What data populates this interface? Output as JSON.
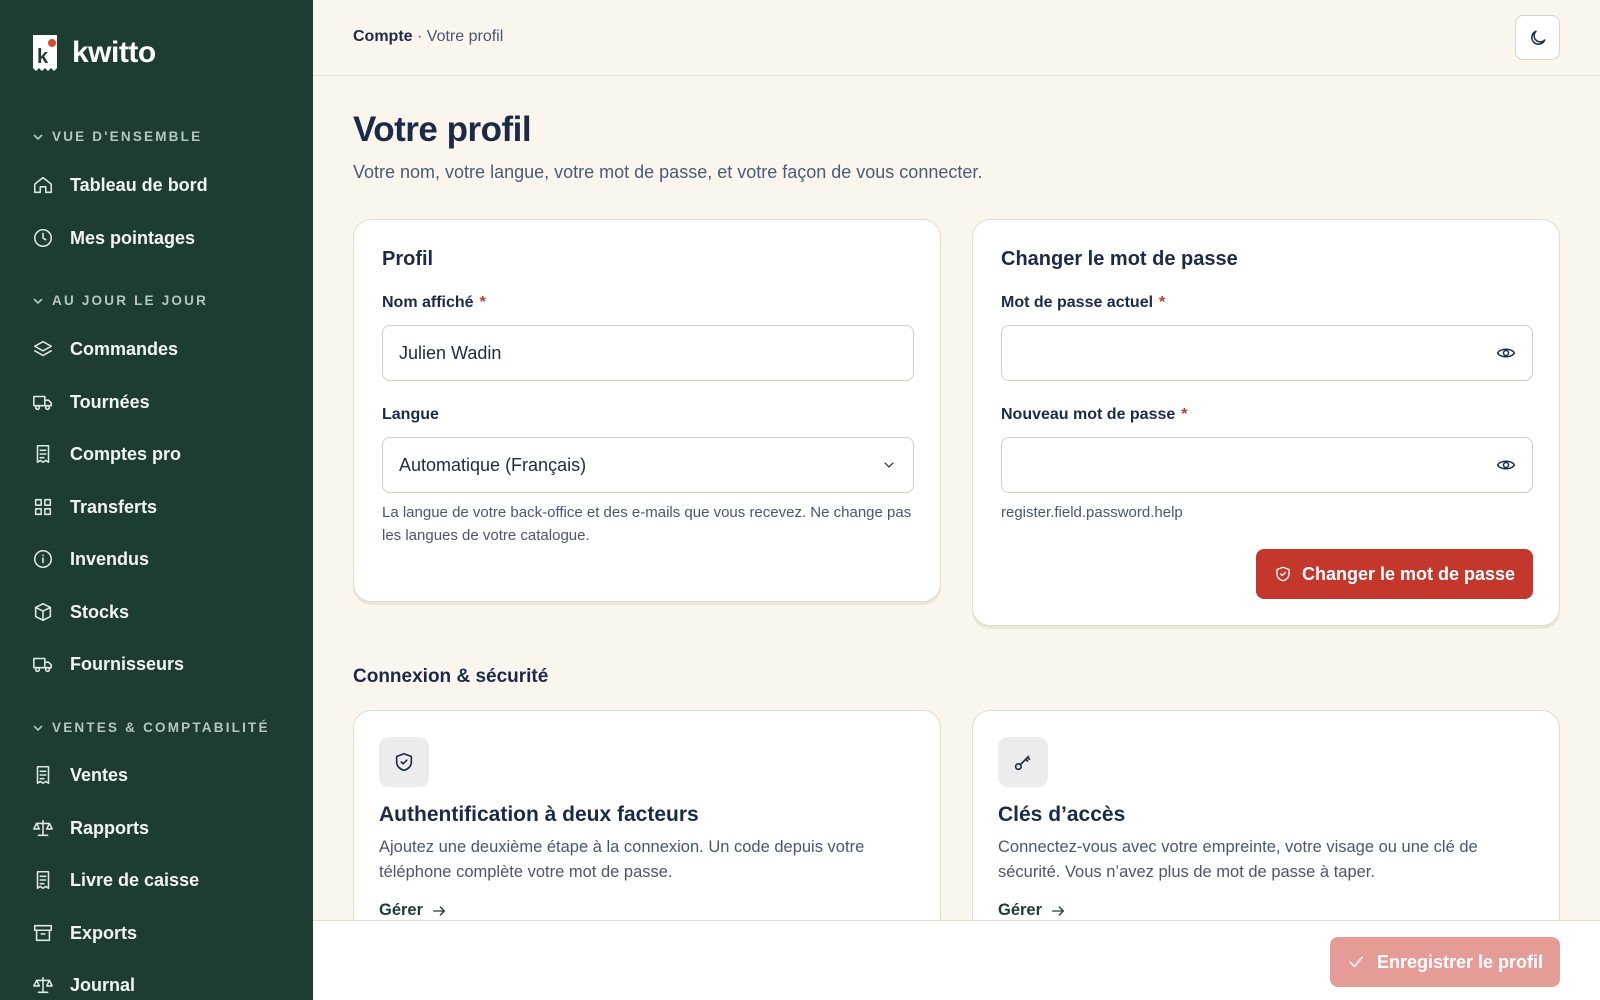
{
  "app": {
    "name": "kwitto"
  },
  "sidebar": {
    "sections": [
      {
        "label": "VUE D'ENSEMBLE",
        "items": [
          {
            "label": "Tableau de bord",
            "icon": "home-icon"
          },
          {
            "label": "Mes pointages",
            "icon": "clock-icon"
          }
        ]
      },
      {
        "label": "AU JOUR LE JOUR",
        "items": [
          {
            "label": "Commandes",
            "icon": "layers-icon"
          },
          {
            "label": "Tournées",
            "icon": "truck-icon"
          },
          {
            "label": "Comptes pro",
            "icon": "receipt-icon"
          },
          {
            "label": "Transferts",
            "icon": "grid-icon"
          },
          {
            "label": "Invendus",
            "icon": "info-icon"
          },
          {
            "label": "Stocks",
            "icon": "box-icon"
          },
          {
            "label": "Fournisseurs",
            "icon": "truck-icon"
          }
        ]
      },
      {
        "label": "VENTES & COMPTABILITÉ",
        "items": [
          {
            "label": "Ventes",
            "icon": "receipt-icon"
          },
          {
            "label": "Rapports",
            "icon": "scale-icon"
          },
          {
            "label": "Livre de caisse",
            "icon": "receipt-icon"
          },
          {
            "label": "Exports",
            "icon": "archive-icon"
          },
          {
            "label": "Journal",
            "icon": "scale-icon"
          }
        ]
      }
    ]
  },
  "breadcrumb": {
    "parent": "Compte",
    "separator": " · ",
    "current": "Votre profil"
  },
  "page": {
    "title": "Votre profil",
    "subtitle": "Votre nom, votre langue, votre mot de passe, et votre façon de vous connecter."
  },
  "profile_card": {
    "title": "Profil",
    "name_label": "Nom affiché",
    "name_value": "Julien Wadin",
    "language_label": "Langue",
    "language_value": "Automatique (Français)",
    "language_help": "La langue de votre back-office et des e-mails que vous recevez. Ne change pas les langues de votre catalogue."
  },
  "password_card": {
    "title": "Changer le mot de passe",
    "current_label": "Mot de passe actuel",
    "new_label": "Nouveau mot de passe",
    "help": "register.field.password.help",
    "submit_label": "Changer le mot de passe"
  },
  "security": {
    "title": "Connexion & sécurité",
    "two_factor": {
      "title": "Authentification à deux facteurs",
      "description": "Ajoutez une deuxième étape à la connexion. Un code depuis votre téléphone complète votre mot de passe.",
      "link": "Gérer"
    },
    "passkeys": {
      "title": "Clés d’accès",
      "description": "Connectez-vous avec votre empreinte, votre visage ou une clé de sécurité. Vous n’avez plus de mot de passe à taper.",
      "link": "Gérer"
    }
  },
  "footer": {
    "save_label": "Enregistrer le profil"
  },
  "colors": {
    "sidebar": "#1c3d2f",
    "accent_red": "#c4372c",
    "background": "#faf6ee"
  }
}
